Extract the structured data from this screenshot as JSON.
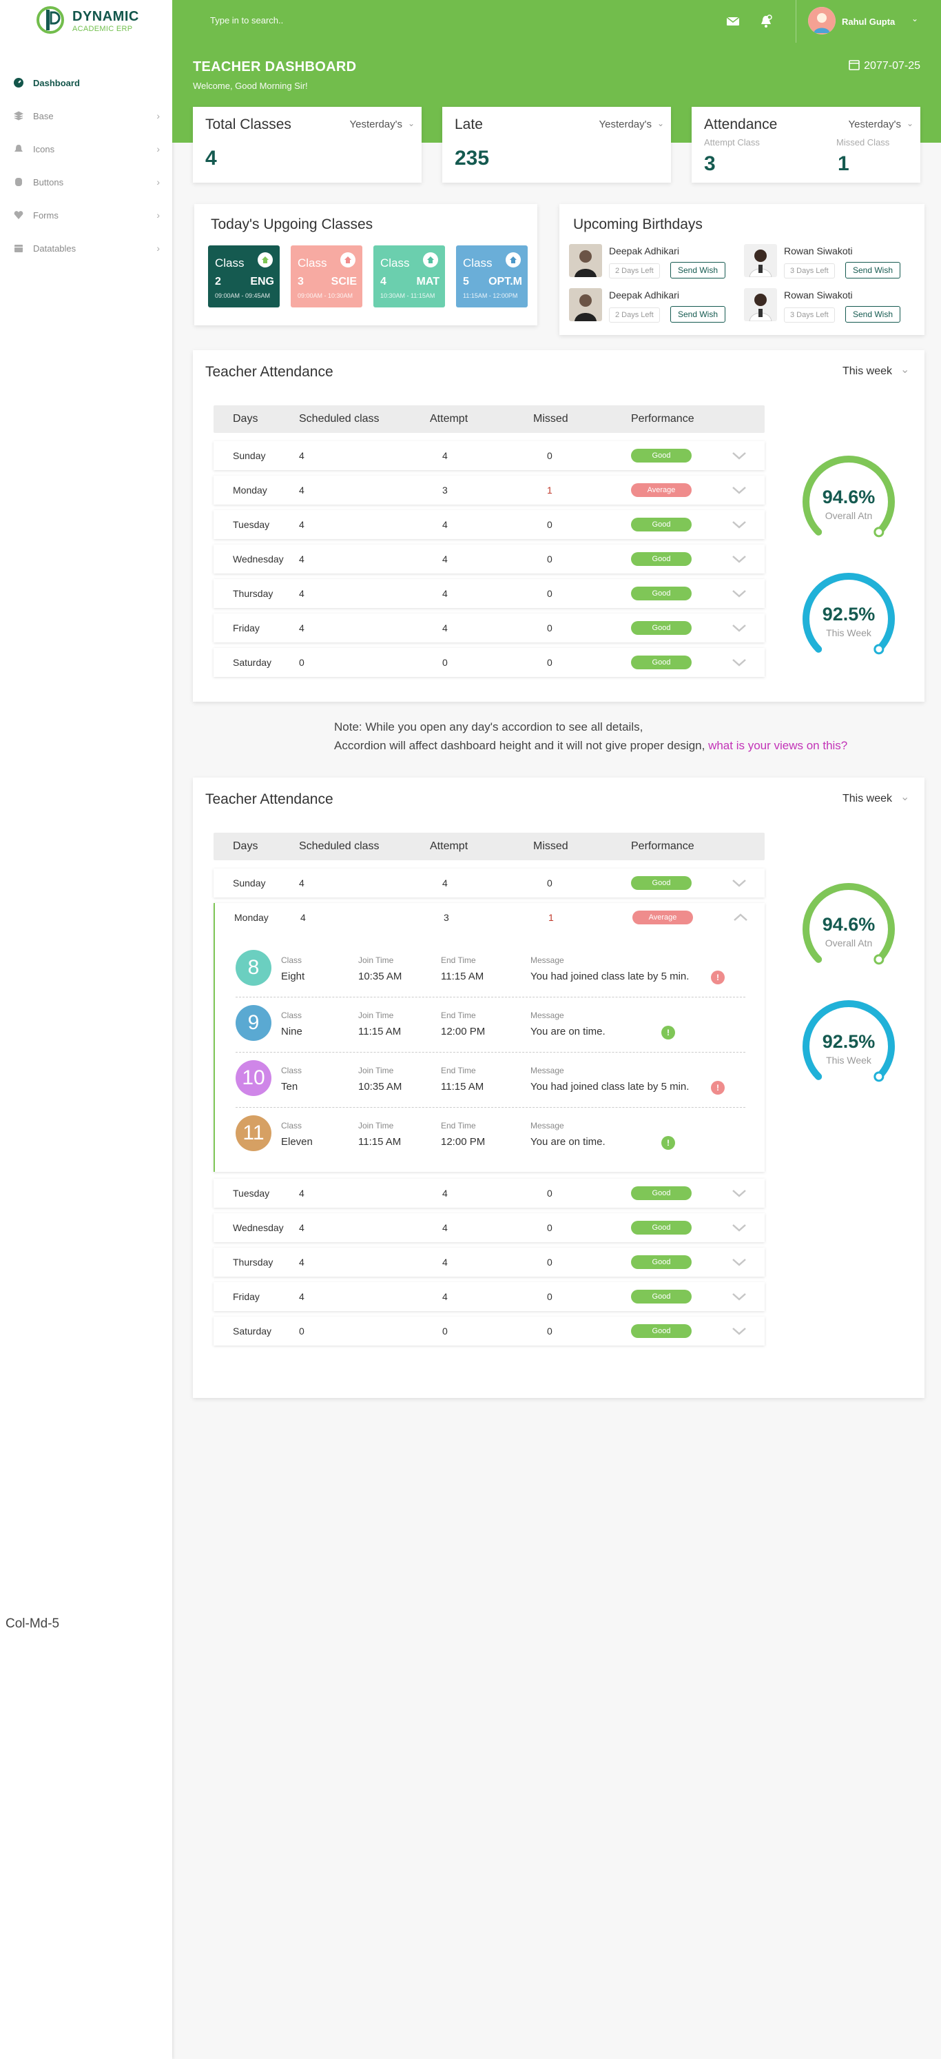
{
  "brand": {
    "name": "DYNAMIC",
    "sub": "ACADEMIC ERP",
    "green": "#72bd4c",
    "dark": "#155a50"
  },
  "sidebar": {
    "items": [
      {
        "label": "Dashboard",
        "icon": "dashboard-icon",
        "active": true
      },
      {
        "label": "Base",
        "icon": "layers-icon"
      },
      {
        "label": "Icons",
        "icon": "bell-icon"
      },
      {
        "label": "Buttons",
        "icon": "database-icon"
      },
      {
        "label": "Forms",
        "icon": "heart-icon"
      },
      {
        "label": "Datatables",
        "icon": "calendar-icon"
      }
    ],
    "footer_text": "Col-Md-5"
  },
  "topbar": {
    "search_placeholder": "Type in to search..",
    "user_name": "Rahul Gupta"
  },
  "hero": {
    "title": "TEACHER DASHBOARD",
    "subtitle": "Welcome, Good Morning Sir!",
    "date": "2077-07-25"
  },
  "stats": {
    "total": {
      "label": "Total Classes",
      "filter": "Yesterday's",
      "value": "4"
    },
    "late": {
      "label": "Late",
      "filter": "Yesterday's",
      "value": "235"
    },
    "attendance": {
      "label": "Attendance",
      "filter": "Yesterday's",
      "attempt_label": "Attempt Class",
      "attempt": "3",
      "missed_label": "Missed Class",
      "missed": "1"
    }
  },
  "upcoming": {
    "title": "Today's Upgoing Classes",
    "classes": [
      {
        "label": "Class",
        "num": "2",
        "subject": "ENG",
        "time": "09:00AM - 09:45AM",
        "color": "#155a50",
        "icon_color": "#7fc657"
      },
      {
        "label": "Class",
        "num": "3",
        "subject": "SCIE",
        "time": "09:00AM - 10:30AM",
        "color": "#f7aaa2",
        "icon_color": "#ef8c8c"
      },
      {
        "label": "Class",
        "num": "4",
        "subject": "MAT",
        "time": "10:30AM - 11:15AM",
        "color": "#6bcfae",
        "icon_color": "#52bfa0"
      },
      {
        "label": "Class",
        "num": "5",
        "subject": "OPT.M",
        "time": "11:15AM - 12:00PM",
        "color": "#6aaed8",
        "icon_color": "#4d98c8"
      }
    ]
  },
  "birthdays": {
    "title": "Upcoming Birthdays",
    "items": [
      {
        "name": "Deepak Adhikari",
        "left": "2 Days Left",
        "btn": "Send Wish"
      },
      {
        "name": "Rowan Siwakoti",
        "left": "3 Days Left",
        "btn": "Send Wish"
      },
      {
        "name": "Deepak Adhikari",
        "left": "2 Days Left",
        "btn": "Send Wish"
      },
      {
        "name": "Rowan Siwakoti",
        "left": "3 Days Left",
        "btn": "Send Wish"
      }
    ]
  },
  "attendance_table": {
    "title": "Teacher Attendance",
    "period": "This week",
    "headers": [
      "Days",
      "Scheduled class",
      "Attempt",
      "Missed",
      "Performance"
    ],
    "rows": [
      {
        "day": "Sunday",
        "scheduled": "4",
        "attempt": "4",
        "missed": "0",
        "perf": "Good"
      },
      {
        "day": "Monday",
        "scheduled": "4",
        "attempt": "3",
        "missed": "1",
        "perf": "Average"
      },
      {
        "day": "Tuesday",
        "scheduled": "4",
        "attempt": "4",
        "missed": "0",
        "perf": "Good"
      },
      {
        "day": "Wednesday",
        "scheduled": "4",
        "attempt": "4",
        "missed": "0",
        "perf": "Good"
      },
      {
        "day": "Thursday",
        "scheduled": "4",
        "attempt": "4",
        "missed": "0",
        "perf": "Good"
      },
      {
        "day": "Friday",
        "scheduled": "4",
        "attempt": "4",
        "missed": "0",
        "perf": "Good"
      },
      {
        "day": "Saturday",
        "scheduled": "0",
        "attempt": "0",
        "missed": "0",
        "perf": "Good"
      }
    ],
    "gauges": [
      {
        "value": "94.6%",
        "label": "Overall Atn",
        "fraction": 0.946,
        "color": "#7fc657"
      },
      {
        "value": "92.5%",
        "label": "This Week",
        "fraction": 0.925,
        "color": "#20b1d8"
      }
    ]
  },
  "note": {
    "line1": "Note: While you open any day's accordion to see all details,",
    "line2": "Accordion will affect dashboard height  and it will not give proper design, ",
    "link": "what is your views on this?"
  },
  "monday_details": {
    "labels": {
      "class": "Class",
      "join": "Join Time",
      "end": "End Time",
      "message": "Message"
    },
    "items": [
      {
        "num": "8",
        "class": "Eight",
        "join": "10:35 AM",
        "end": "11:15 AM",
        "message": "You had joined class late by 5 min.",
        "status": "late",
        "color": "#6bcfc0"
      },
      {
        "num": "9",
        "class": "Nine",
        "join": "11:15 AM",
        "end": "12:00 PM",
        "message": "You are on time.",
        "status": "ok",
        "color": "#5aa9d2"
      },
      {
        "num": "10",
        "class": "Ten",
        "join": "10:35 AM",
        "end": "11:15 AM",
        "message": "You had joined class late by 5 min.",
        "status": "late",
        "color": "#cf86e8"
      },
      {
        "num": "11",
        "class": "Eleven",
        "join": "11:15 AM",
        "end": "12:00 PM",
        "message": "You are on time.",
        "status": "ok",
        "color": "#d6a063"
      }
    ]
  }
}
